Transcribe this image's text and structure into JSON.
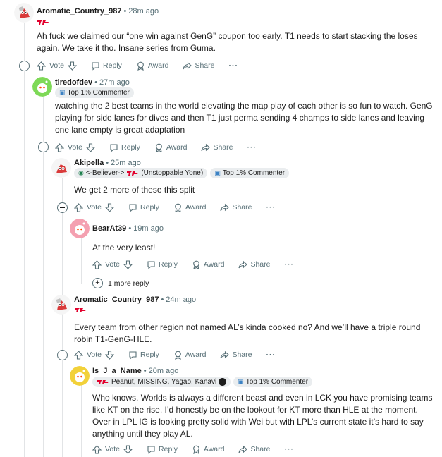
{
  "actions": {
    "vote": "Vote",
    "reply": "Reply",
    "award": "Award",
    "share": "Share",
    "more": "···"
  },
  "comments": [
    {
      "username": "Aromatic_Country_987",
      "time": "28m ago",
      "text": "Ah fuck we claimed our “one win against GenG” coupon too early. T1 needs to start stacking the loses again. We take it tho. Insane series from Guma."
    },
    {
      "username": "tiredofdev",
      "time": "27m ago",
      "flair_badge": "Top 1% Commenter",
      "text": "watching the 2 best teams in the world elevating the map play of each other is so fun to watch. GenG playing for side lanes for dives and then T1 just perma sending 4 champs to side lanes and leaving one lane empty is great adaptation"
    },
    {
      "username": "Akipella",
      "time": "25m ago",
      "flair_user": "<-Believer->",
      "flair_user_2": "(Unstoppable Yone)",
      "flair_badge": "Top 1% Commenter",
      "text": "We get 2 more of these this split"
    },
    {
      "username": "BearAt39",
      "time": "19m ago",
      "text": "At the very least!",
      "more_replies": "1 more reply"
    },
    {
      "username": "Aromatic_Country_987",
      "time": "24m ago",
      "text": "Every team from other region not named AL’s kinda cooked no? And we’ll have a triple round robin T1-GenG-HLE."
    },
    {
      "username": "Is_J_a_Name",
      "time": "20m ago",
      "flair_user": "Peanut, MISSING, Yagao, Kanavi",
      "flair_badge": "Top 1% Commenter",
      "text": "Who knows, Worlds is always a different beast and even in LCK you have promising teams like KT on the rise, I’d honestly be on the lookout for KT more than HLE at the moment. Over in LPL IG is looking pretty solid with Wei but with LPL’s current state it’s hard to say anything until they play AL."
    }
  ],
  "colors": {
    "t1_red": "#e2012d",
    "meta_gray": "#576f76",
    "flair_bg": "#eaedef",
    "thread_line": "#e2e4e6"
  }
}
